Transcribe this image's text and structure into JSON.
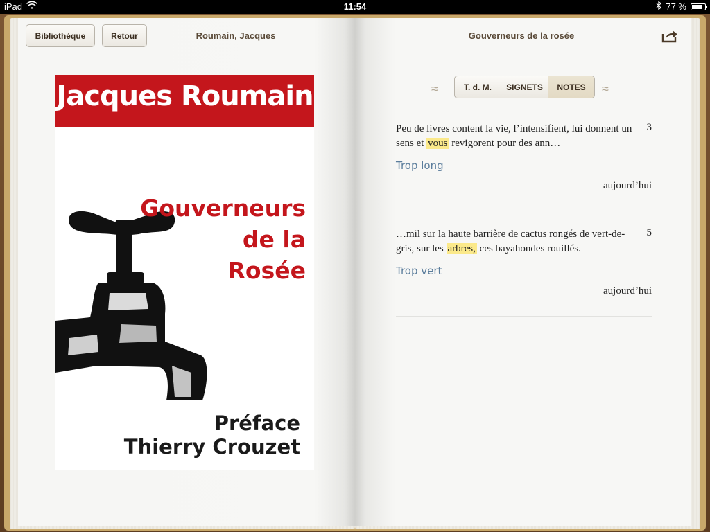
{
  "status": {
    "device": "iPad",
    "time": "11:54",
    "battery": "77 %",
    "battery_level": 0.77,
    "icons": [
      "wifi-icon",
      "bluetooth-icon",
      "battery-icon"
    ]
  },
  "header": {
    "library_button": "Bibliothèque",
    "back_button": "Retour",
    "author": "Roumain, Jacques",
    "book_title": "Gouverneurs de la rosée",
    "share_icon": "share-icon"
  },
  "cover": {
    "author": "Jacques Roumain",
    "title_lines": [
      "Gouverneurs",
      "de la",
      "Rosée"
    ],
    "preface_lines": [
      "Préface",
      "Thierry Crouzet"
    ],
    "colors": {
      "band": "#c4161c",
      "title": "#c4161c"
    }
  },
  "tabs": {
    "items": [
      "T. d. M.",
      "SIGNETS",
      "NOTES"
    ],
    "selected": "NOTES"
  },
  "notes": [
    {
      "before": "Peu de livres content la vie, l’intensifient, lui donnent un sens et ",
      "highlight": "vous",
      "after": " revigorent pour des ann…",
      "page": "3",
      "comment": "Trop long",
      "date": "aujourd’hui"
    },
    {
      "before": "…mil sur la haute barrière de cactus rongés de vert-de-gris, sur les ",
      "highlight": "arbres,",
      "after": " ces bayahondes rouillés.",
      "page": "5",
      "comment": "Trop vert",
      "date": "aujourd’hui"
    }
  ],
  "colors": {
    "highlight": "#fbe98a",
    "comment": "#5b7d9c"
  }
}
